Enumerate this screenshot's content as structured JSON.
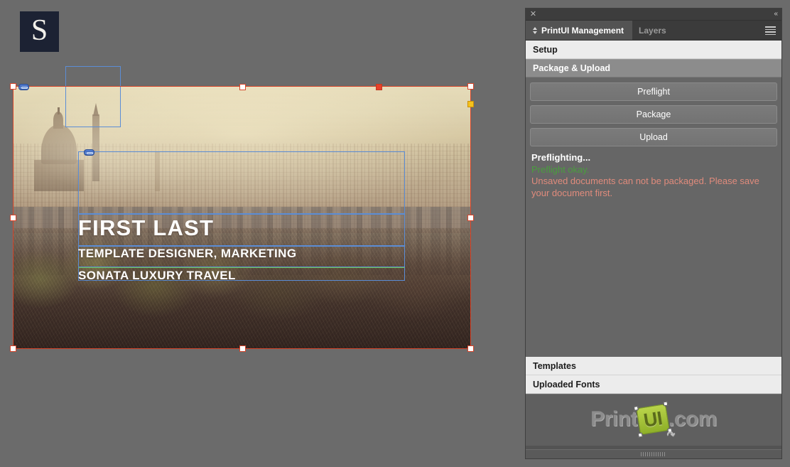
{
  "panel": {
    "titlebar": {
      "close_icon": "close-icon",
      "collapse_icon": "double-chevron-left-icon",
      "collapse_glyph": "«"
    },
    "tabs": [
      {
        "label": "PrintUI Management",
        "active": true,
        "icon": "gem-icon"
      },
      {
        "label": "Layers",
        "active": false
      }
    ],
    "menu_icon": "hamburger-menu-icon",
    "sections": [
      {
        "label": "Setup",
        "style": "light"
      },
      {
        "label": "Package & Upload",
        "style": "grey"
      },
      {
        "label": "Templates",
        "style": "light"
      },
      {
        "label": "Uploaded Fonts",
        "style": "light"
      }
    ],
    "buttons": [
      {
        "label": "Preflight"
      },
      {
        "label": "Package"
      },
      {
        "label": "Upload"
      }
    ],
    "status": {
      "heading": "Preflighting...",
      "ok_message": "Preflight okay.",
      "error_message": "Unsaved documents can not be packaged. Please save your document first."
    },
    "logo": {
      "text_before": "Print",
      "box_text": "UI",
      "text_after": ".com"
    },
    "colors": {
      "panel_bg": "#535353",
      "body_bg": "#666666",
      "section_light": "#ececec",
      "section_grey": "#8c8c8c",
      "status_ok": "#4a9e3e",
      "status_error": "#e08b7c",
      "logo_green": "#a7c93c"
    }
  },
  "document": {
    "logo_letter": "S",
    "texts": {
      "name": "FIRST LAST",
      "role": "TEMPLATE DESIGNER, MARKETING",
      "company": "SONATA LUXURY TRAVEL"
    },
    "frame_colors": {
      "page_border": "#d6452b",
      "text_frame": "#b95fd8",
      "inner_frame": "#5b8dd6",
      "baseline": "#72c24a",
      "handle_white": "#ffffff",
      "handle_red": "#e8412a",
      "handle_yellow": "#f5c21b"
    },
    "icons": {
      "link_badge": "link-badge-icon"
    }
  }
}
